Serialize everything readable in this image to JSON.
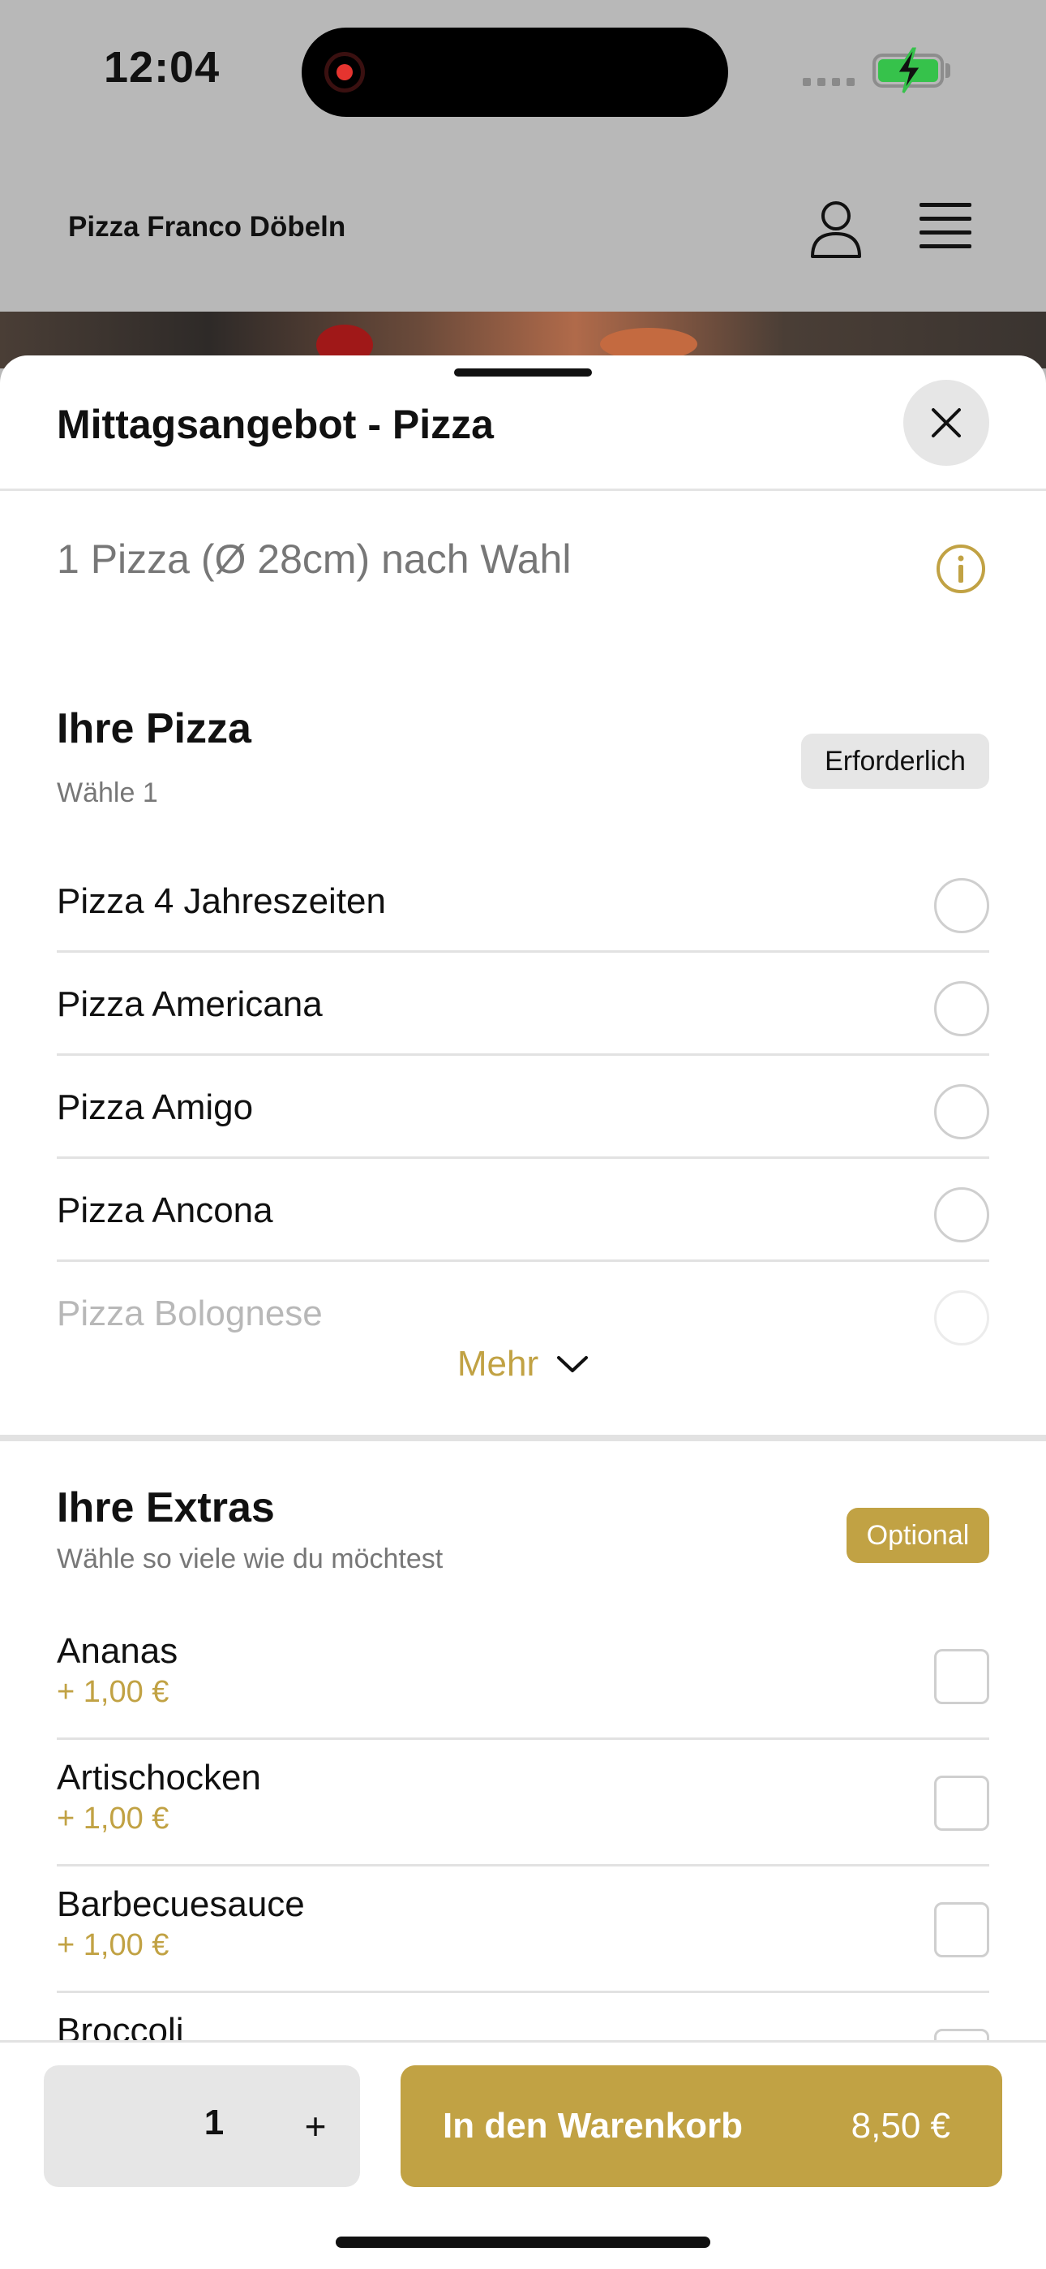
{
  "status_bar": {
    "time": "12:04",
    "battery_color": "#36c24b",
    "recording_indicator_color": "#e5342f"
  },
  "header": {
    "restaurant_name": "Pizza Franco Döbeln",
    "icons": [
      "user-icon",
      "hamburger-menu-icon"
    ]
  },
  "sheet": {
    "title": "Mittagsangebot - Pizza",
    "description": "1 Pizza (Ø 28cm) nach Wahl",
    "close_icon": "close-icon",
    "info_icon": "info-icon"
  },
  "pizza_section": {
    "title": "Ihre Pizza",
    "subtitle": "Wähle 1",
    "badge": "Erforderlich",
    "options": [
      {
        "label": "Pizza 4 Jahreszeiten",
        "selected": false
      },
      {
        "label": "Pizza Americana",
        "selected": false
      },
      {
        "label": "Pizza Amigo",
        "selected": false
      },
      {
        "label": "Pizza Ancona",
        "selected": false
      },
      {
        "label": "Pizza Bolognese",
        "selected": false
      }
    ],
    "more_label": "Mehr"
  },
  "extras_section": {
    "title": "Ihre Extras",
    "subtitle": "Wähle so viele wie du möchtest",
    "badge": "Optional",
    "items": [
      {
        "label": "Ananas",
        "price": "+ 1,00 €",
        "checked": false
      },
      {
        "label": "Artischocken",
        "price": "+ 1,00 €",
        "checked": false
      },
      {
        "label": "Barbecuesauce",
        "price": "+ 1,00 €",
        "checked": false
      },
      {
        "label": "Broccoli",
        "price": "",
        "checked": false
      }
    ]
  },
  "bottom_bar": {
    "quantity": "1",
    "plus_label": "+",
    "cart_label": "In den Warenkorb",
    "cart_price": "8,50 €"
  },
  "colors": {
    "accent": "#c1a244",
    "overlay": "#b8b8b8",
    "sheet_background": "#ffffff"
  }
}
